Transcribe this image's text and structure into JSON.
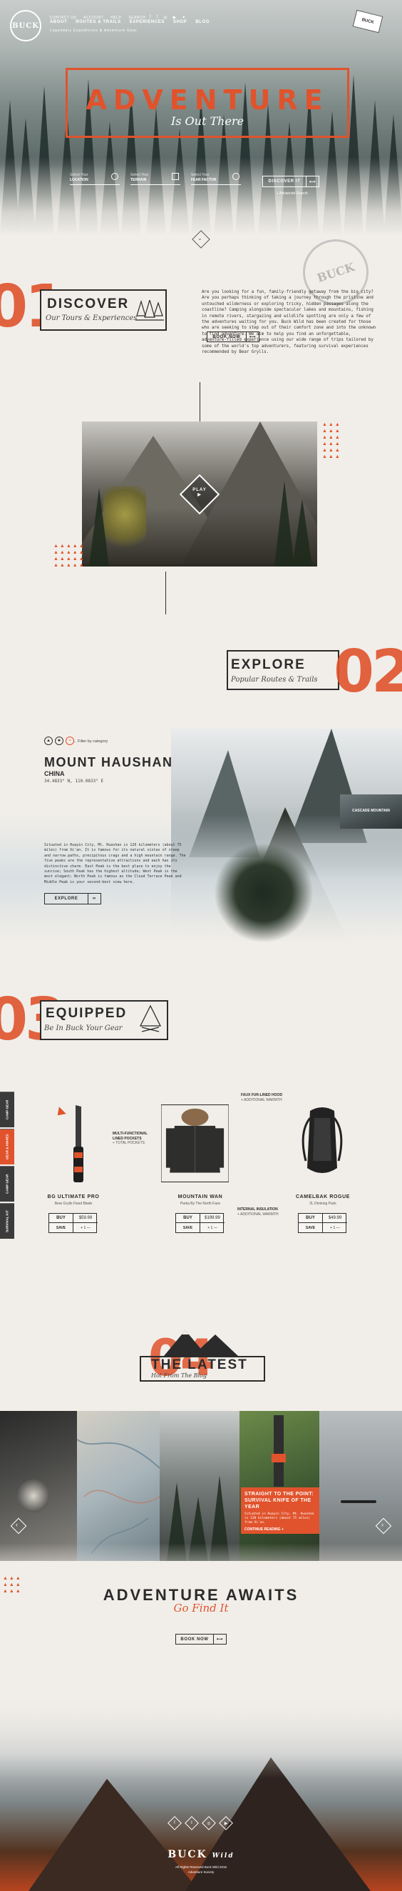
{
  "brand": {
    "logo": "BUCK",
    "badge": "BUCK"
  },
  "topnav": [
    "CONTACT US",
    "ACCOUNT",
    "HELP",
    "SEARCH"
  ],
  "social": [
    "f",
    "t",
    "◎",
    "▶",
    "✦"
  ],
  "mainnav": [
    "ABOUT",
    "ROUTES & TRAILS",
    "EXPERIENCES",
    "SHOP",
    "BLOG"
  ],
  "tagline": "Legendary Expeditions & Adventure Gear",
  "hero": {
    "title": "ADVENTURE",
    "subtitle": "Is Out There",
    "selectors": [
      {
        "label": "Select Your",
        "value": "LOCATION"
      },
      {
        "label": "Select Your",
        "value": "TERRAIN"
      },
      {
        "label": "Select Your",
        "value": "FEAR FACTOR"
      }
    ],
    "cta": "DISCOVER IT",
    "advanced": "+ Advanced Search"
  },
  "discover": {
    "number": "01",
    "title": "DISCOVER",
    "subtitle": "Our Tours & Experiences",
    "body": "Are you looking for a fun, family-friendly getaway from the big city? Are you perhaps thinking of taking a journey through the pristine and untouched wilderness or exploring tricky, hidden passages along the coastline? Camping alongside spectacular lakes and mountains, fishing in remote rivers, stargazing and wildlife spotting are only a few of the adventures waiting for you. Buck Wild has been created for those who are seeking to step out of their comfort zone and into the unknown to find adventure. We aim to help you find an unforgettable, adventure-filled experience using our wide range of trips tailored by some of the world's top adventurers, featuring survival experiences recommended by Bear Grylls.",
    "cta": "BOOK NOW"
  },
  "video": {
    "play_label": "PLAY"
  },
  "explore": {
    "number": "02",
    "title": "EXPLORE",
    "subtitle": "Popular Routes & Trails"
  },
  "location": {
    "filter_label": "Filter by category",
    "title": "MOUNT HAUSHAN",
    "country": "CHINA",
    "coords": "34.4833° N, 110.0833° E",
    "body": "Situated in Huayin City, Mt. Huashan is 120 kilometers (about 75 miles) from Xi'an. It is famous for its natural vistas of steep and narrow paths, precipitous crags and a high mountain range. The five peaks are the representative attractions and each has its distinctive charm. East Peak is the best place to enjoy the sunrise; South Peak has the highest altitude; West Peak is the most elegant; North Peak is famous as the Cloud Terrace Peak and Middle Peak is your second-best view here.",
    "cta": "EXPLORE",
    "side_thumb": "CASCADE MOUNTAIN"
  },
  "equipped": {
    "number": "03",
    "title": "EQUIPPED",
    "subtitle": "Be In Buck Your Gear",
    "side_tabs": [
      "CAMP GEAR",
      "GEAR & KNIVES",
      "CAMP GEAR",
      "SURVIVAL KIT"
    ],
    "products": [
      {
        "name": "BG ULTIMATE PRO",
        "desc": "Bear Grylls Fixed Blade",
        "buy": "BUY",
        "price": "$59.99",
        "save": "SAVE",
        "qty": "+ 1 —"
      },
      {
        "name": "MOUNTAIN WAN",
        "desc": "Parka By The North Face",
        "buy": "BUY",
        "price": "$199.99",
        "save": "SAVE",
        "qty": "+ 1 —"
      },
      {
        "name": "CAMELBAK ROGUE",
        "desc": "2L Drinking Pack",
        "buy": "BUY",
        "price": "$49.99",
        "save": "SAVE",
        "qty": "+ 1 —"
      }
    ],
    "callouts": [
      {
        "title": "FAUX FUR-LINED HOOD",
        "sub": "+ ADDITIONAL WARMTH"
      },
      {
        "title": "MULTI-FUNCTIONAL LINED POCKETS",
        "sub": "+ TOTAL POCKETS"
      },
      {
        "title": "INTERNAL INSULATION",
        "sub": "+ ADDITIONAL WARMTH"
      }
    ]
  },
  "latest": {
    "number": "04",
    "title": "THE LATEST",
    "subtitle": "Hot From The Blog",
    "caption_title": "STRAIGHT TO THE POINT: SURVIVAL KNIFE OF THE YEAR",
    "caption_body": "Situated in Huayin City, Mt. Huashan is 120 kilometers (about 75 miles) from Xi'an.",
    "caption_link": "CONTINUE READING +"
  },
  "awaits": {
    "title": "ADVENTURE AWAITS",
    "subtitle": "Go Find It",
    "cta": "BOOK NOW"
  },
  "footer": {
    "logo": "BUCK",
    "logo_sub": "Wild",
    "copy1": "All Rights Reserved Buck Wild 2016",
    "copy2": "Adventure Society"
  },
  "colors": {
    "accent": "#e0532c",
    "ink": "#2b2b2b",
    "paper": "#f1eee9"
  }
}
